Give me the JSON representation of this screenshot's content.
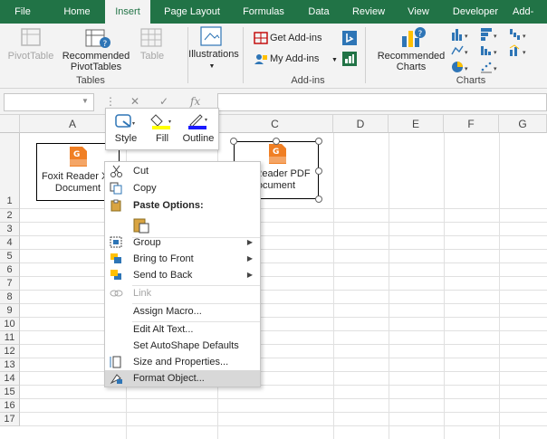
{
  "ribbon_tabs": [
    "File",
    "Home",
    "Insert",
    "Page Layout",
    "Formulas",
    "Data",
    "Review",
    "View",
    "Developer",
    "Add-"
  ],
  "active_tab": "Insert",
  "ribbon": {
    "tables": {
      "pivot": "PivotTable",
      "rec_pivot_1": "Recommended",
      "rec_pivot_2": "PivotTables",
      "table": "Table",
      "group": "Tables"
    },
    "illustrations": "Illustrations",
    "addins": {
      "get": "Get Add-ins",
      "my": "My Add-ins",
      "group": "Add-ins"
    },
    "charts": {
      "rec_1": "Recommended",
      "rec_2": "Charts",
      "group": "Charts"
    }
  },
  "formula_bar": {
    "cancel": "✕",
    "enter": "✓",
    "fx": "fx"
  },
  "columns": [
    "A",
    "B",
    "C",
    "D",
    "E",
    "F",
    "G"
  ],
  "rows": [
    "1",
    "2",
    "3",
    "4",
    "5",
    "6",
    "7",
    "8",
    "9",
    "10",
    "11",
    "12",
    "13",
    "14",
    "15",
    "16",
    "17"
  ],
  "shapes": {
    "left": {
      "line1": "Foxit Reader XF",
      "line2": "Document"
    },
    "right": {
      "line1": "Reader PDF",
      "line2": "ocument"
    },
    "icon_label": "PDF"
  },
  "mini_toolbar": {
    "style": "Style",
    "fill": "Fill",
    "outline": "Outline"
  },
  "context_menu": {
    "cut": "Cut",
    "copy": "Copy",
    "paste_header": "Paste Options:",
    "group": "Group",
    "bring_front": "Bring to Front",
    "send_back": "Send to Back",
    "link": "Link",
    "assign_macro": "Assign Macro...",
    "edit_alt": "Edit Alt Text...",
    "set_defaults": "Set AutoShape Defaults",
    "size_props": "Size and Properties...",
    "format_object": "Format Object..."
  },
  "colors": {
    "excel_green": "#217346",
    "fill_yellow": "#ffff00",
    "outline_blue": "#1a1aff",
    "foxit_orange": "#f07f24"
  }
}
